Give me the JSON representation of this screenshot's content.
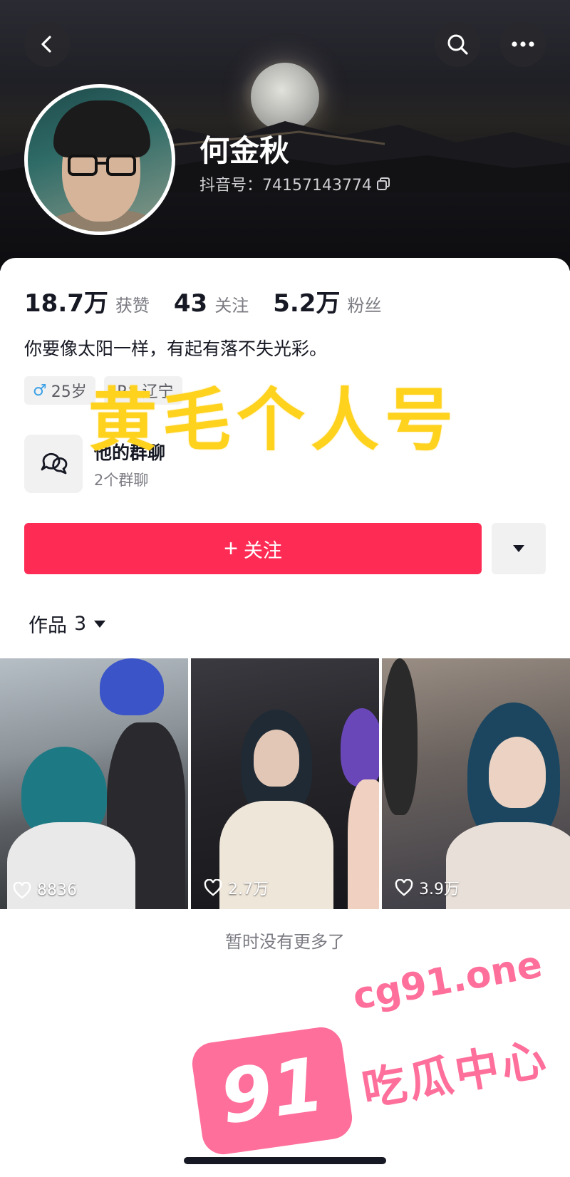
{
  "header": {
    "back_icon": "chevron-left-icon",
    "search_icon": "search-icon",
    "more_icon": "more-horizontal-icon"
  },
  "profile": {
    "name": "何金秋",
    "douyin_id": "抖音号：74157143774",
    "copy_icon": "copy-icon"
  },
  "stats": [
    {
      "value": "18.7万",
      "label": "获赞"
    },
    {
      "value": "43",
      "label": "关注"
    },
    {
      "value": "5.2万",
      "label": "粉丝"
    }
  ],
  "bio": "你要像太阳一样，有起有落不失光彩。",
  "tags": {
    "gender_icon": "♂",
    "age": "25岁",
    "ip": "IP：辽宁"
  },
  "group_chat": {
    "title": "他的群聊",
    "subtitle": "2个群聊",
    "icon": "chat-bubbles-icon"
  },
  "overlay_caption": "黄毛个人号",
  "actions": {
    "follow_plus": "+",
    "follow_label": "关注",
    "dropdown_icon": "triangle-down-icon"
  },
  "works": {
    "label": "作品",
    "count": "3",
    "items": [
      {
        "likes": "8836"
      },
      {
        "likes": "2.7万"
      },
      {
        "likes": "3.9万"
      }
    ]
  },
  "footer_text": "暂时没有更多了",
  "watermark": {
    "number": "91",
    "site": "cg91.one",
    "name": "吃瓜中心"
  },
  "colors": {
    "accent": "#fe2c55",
    "overlay": "#ffd21e",
    "watermark": "#ff6f9b"
  }
}
